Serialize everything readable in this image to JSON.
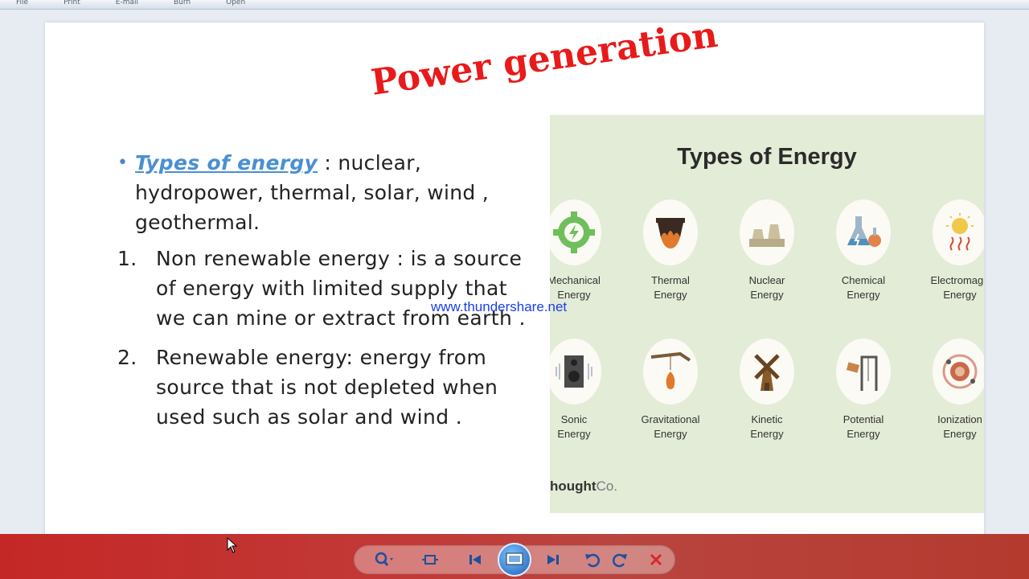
{
  "menu": [
    "File",
    "Print",
    "E-mail",
    "Burn",
    "Open"
  ],
  "slide": {
    "title": "Power generation",
    "bullet": {
      "term": "Types of energy",
      "text": " : nuclear, hydropower, thermal, solar, wind , geothermal."
    },
    "items": [
      {
        "num": "1.",
        "text": "Non renewable energy : is a source of energy with limited supply that we can mine or extract from earth ."
      },
      {
        "num": "2.",
        "text": "Renewable energy: energy from source that is not depleted when used such as solar and wind ."
      }
    ],
    "watermark": "www.thundershare.net"
  },
  "infographic": {
    "title": "Types of Energy",
    "types": [
      {
        "label": "Mechanical\nEnergy",
        "icon": "gear-bolt-icon"
      },
      {
        "label": "Thermal\nEnergy",
        "icon": "pot-fire-icon"
      },
      {
        "label": "Nuclear\nEnergy",
        "icon": "nuclear-plant-icon"
      },
      {
        "label": "Chemical\nEnergy",
        "icon": "flask-icon"
      },
      {
        "label": "Electromagn\nEnergy",
        "icon": "sun-icon"
      },
      {
        "label": "Sonic\nEnergy",
        "icon": "speaker-icon"
      },
      {
        "label": "Gravitational\nEnergy",
        "icon": "falling-apple-icon"
      },
      {
        "label": "Kinetic\nEnergy",
        "icon": "windmill-icon"
      },
      {
        "label": "Potential\nEnergy",
        "icon": "pulley-icon"
      },
      {
        "label": "Ionization\nEnergy",
        "icon": "atom-icon"
      }
    ],
    "brand_main": "hought",
    "brand_co": "Co."
  },
  "toolbar": {
    "buttons": [
      "zoom-icon",
      "fit-icon",
      "previous-icon",
      "slideshow-icon",
      "next-icon",
      "rotate-left-icon",
      "rotate-right-icon",
      "delete-icon"
    ]
  },
  "colors": {
    "title": "#e81a1a",
    "accent": "#4a90d0",
    "watermark": "#1a3fe8",
    "infographic_bg": "#e3ecd6"
  }
}
